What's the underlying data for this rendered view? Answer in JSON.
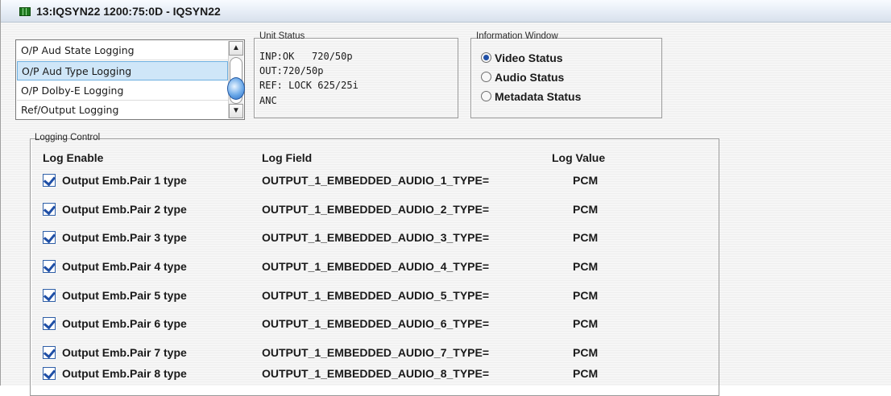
{
  "window": {
    "title": "13:IQSYN22  1200:75:0D  - IQSYN22",
    "title_icon": "device-icon"
  },
  "log_list": {
    "items": [
      {
        "label": "O/P Aud State Logging",
        "selected": false
      },
      {
        "label": "O/P Aud Type Logging",
        "selected": true
      },
      {
        "label": "O/P Dolby-E Logging",
        "selected": false
      },
      {
        "label": "Ref/Output Logging",
        "selected": false
      }
    ],
    "scroll_up_icon": "chevron-up-icon",
    "scroll_down_icon": "chevron-down-icon"
  },
  "unit_status": {
    "label": "Unit Status",
    "lines": [
      "INP:OK   720/50p",
      "OUT:720/50p",
      "REF: LOCK 625/25i",
      "ANC"
    ]
  },
  "info_window": {
    "label": "Information Window",
    "options": [
      {
        "label": "Video Status",
        "checked": true
      },
      {
        "label": "Audio Status",
        "checked": false
      },
      {
        "label": "Metadata Status",
        "checked": false
      }
    ]
  },
  "logging_control": {
    "label": "Logging Control",
    "columns": [
      "Log Enable",
      "Log Field",
      "Log Value"
    ],
    "rows": [
      {
        "enable": "Output Emb.Pair 1 type",
        "checked": true,
        "field": "OUTPUT_1_EMBEDDED_AUDIO_1_TYPE=",
        "value": "PCM"
      },
      {
        "enable": "Output Emb.Pair 2 type",
        "checked": true,
        "field": "OUTPUT_1_EMBEDDED_AUDIO_2_TYPE=",
        "value": "PCM"
      },
      {
        "enable": "Output Emb.Pair 3 type",
        "checked": true,
        "field": "OUTPUT_1_EMBEDDED_AUDIO_3_TYPE=",
        "value": "PCM"
      },
      {
        "enable": "Output Emb.Pair 4 type",
        "checked": true,
        "field": "OUTPUT_1_EMBEDDED_AUDIO_4_TYPE=",
        "value": "PCM"
      },
      {
        "enable": "Output Emb.Pair 5 type",
        "checked": true,
        "field": "OUTPUT_1_EMBEDDED_AUDIO_5_TYPE=",
        "value": "PCM"
      },
      {
        "enable": "Output Emb.Pair 6 type",
        "checked": true,
        "field": "OUTPUT_1_EMBEDDED_AUDIO_6_TYPE=",
        "value": "PCM"
      },
      {
        "enable": "Output Emb.Pair 7 type",
        "checked": true,
        "field": "OUTPUT_1_EMBEDDED_AUDIO_7_TYPE=",
        "value": "PCM"
      },
      {
        "enable": "Output Emb.Pair 8 type",
        "checked": true,
        "field": "OUTPUT_1_EMBEDDED_AUDIO_8_TYPE=",
        "value": "PCM"
      }
    ]
  }
}
